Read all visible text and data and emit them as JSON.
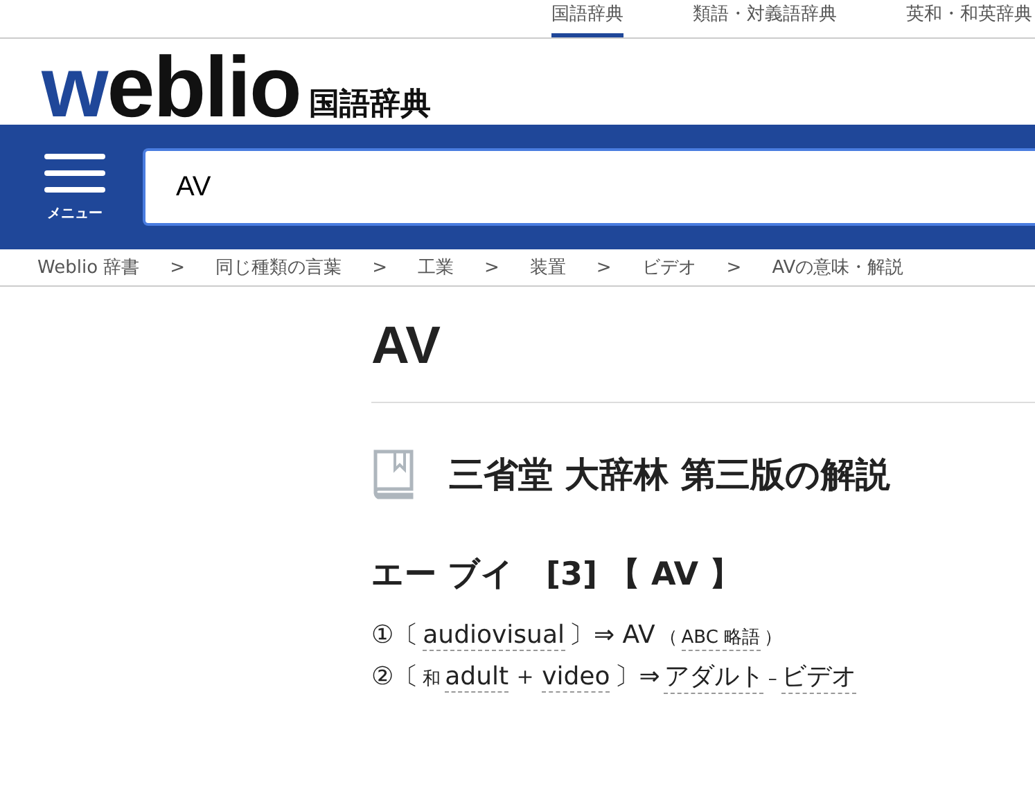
{
  "top_tabs": [
    {
      "label": "国語辞典",
      "selected": true
    },
    {
      "label": "類語・対義語辞典",
      "selected": false
    },
    {
      "label": "英和・和英辞典",
      "selected": false
    }
  ],
  "logo": {
    "accent": "w",
    "rest": "eblio",
    "dictionary": "国語辞典"
  },
  "menu_button": {
    "label": "メニュー"
  },
  "search": {
    "value": "AV"
  },
  "breadcrumbs": [
    {
      "label": "Weblio 辞書"
    },
    {
      "label": "同じ種類の言葉"
    },
    {
      "label": "工業"
    },
    {
      "label": "装置"
    },
    {
      "label": "ビデオ"
    },
    {
      "label": "AVの意味・解説"
    }
  ],
  "breadcrumb_separator": ">",
  "entry_title": "AV",
  "source_heading": "三省堂 大辞林 第三版の解説",
  "headword": "エー ブイ　[3] 【 AV 】",
  "definitions": [
    {
      "segments": [
        {
          "text": "①〔",
          "kind": "plain"
        },
        {
          "text": "audiovisual",
          "kind": "link"
        },
        {
          "text": "〕⇒ AV",
          "kind": "plain"
        },
        {
          "text": "（",
          "kind": "small"
        },
        {
          "text": "ABC 略語",
          "kind": "smalllink"
        },
        {
          "text": "）",
          "kind": "small"
        }
      ]
    },
    {
      "segments": [
        {
          "text": "②〔",
          "kind": "plain"
        },
        {
          "text": "和",
          "kind": "small"
        },
        {
          "text": "adult",
          "kind": "link"
        },
        {
          "text": "＋",
          "kind": "plain"
        },
        {
          "text": "video",
          "kind": "link"
        },
        {
          "text": "〕⇒",
          "kind": "plain"
        },
        {
          "text": "アダルト",
          "kind": "link"
        },
        {
          "text": "–",
          "kind": "small"
        },
        {
          "text": "ビデオ",
          "kind": "link"
        }
      ]
    }
  ]
}
